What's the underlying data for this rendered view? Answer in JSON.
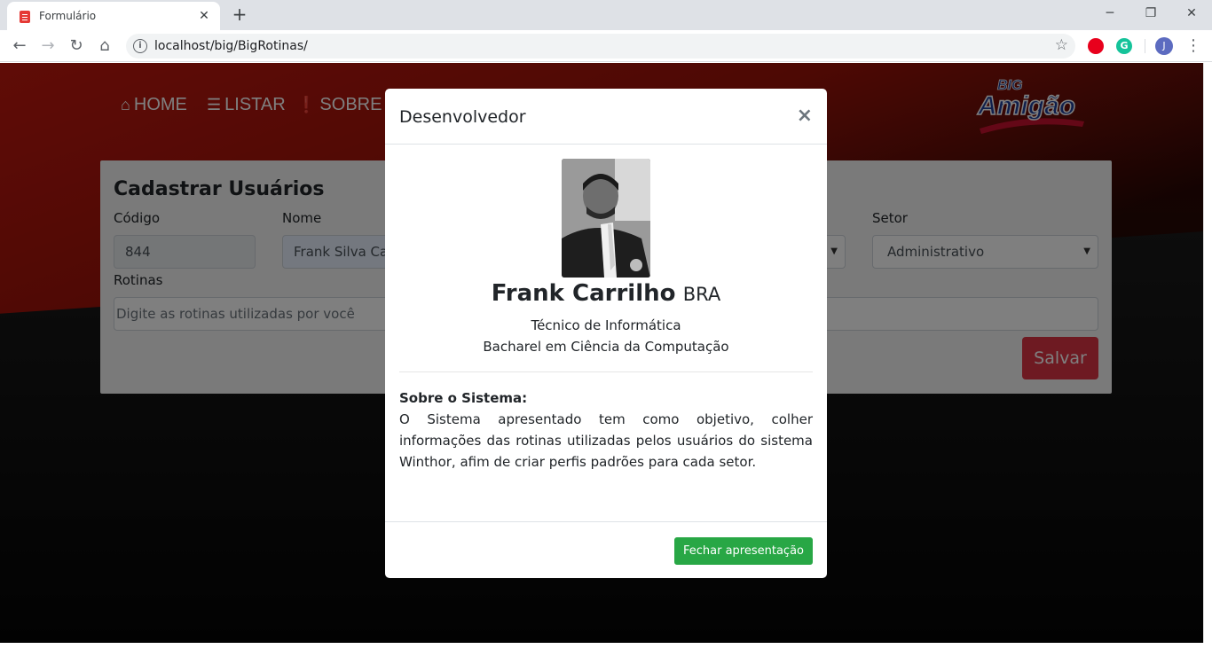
{
  "browser": {
    "tab_title": "Formulário",
    "url": "localhost/big/BigRotinas/",
    "profile_initial": "J",
    "grammarly_letter": "G"
  },
  "nav": {
    "home": "HOME",
    "list": "LISTAR",
    "about": "SOBRE"
  },
  "logo": {
    "top_text": "BIG",
    "main_text": "Amigão"
  },
  "form": {
    "title": "Cadastrar Usuários",
    "code_label": "Código",
    "code_value": "844",
    "name_label": "Nome",
    "name_value": "Frank Silva Carrilho",
    "sector_label": "Setor",
    "sector_value": "Administrativo",
    "routines_label": "Rotinas",
    "routines_placeholder": "Digite as rotinas utilizadas por você",
    "save_label": "Salvar"
  },
  "modal": {
    "title": "Desenvolvedor",
    "close_symbol": "×",
    "name": "Frank Carrilho",
    "country": "BRA",
    "role": "Técnico de Informática",
    "degree": "Bacharel em Ciência da Computação",
    "about_title": "Sobre o Sistema:",
    "about_text": "O Sistema apresentado tem como objetivo, colher informações das rotinas utilizadas pelos usuários do sistema Winthor, afim de criar perfis padrões para cada setor.",
    "close_button": "Fechar apresentação"
  },
  "colors": {
    "danger": "#dc3545",
    "success": "#28a745",
    "header_red": "#b3150c"
  }
}
